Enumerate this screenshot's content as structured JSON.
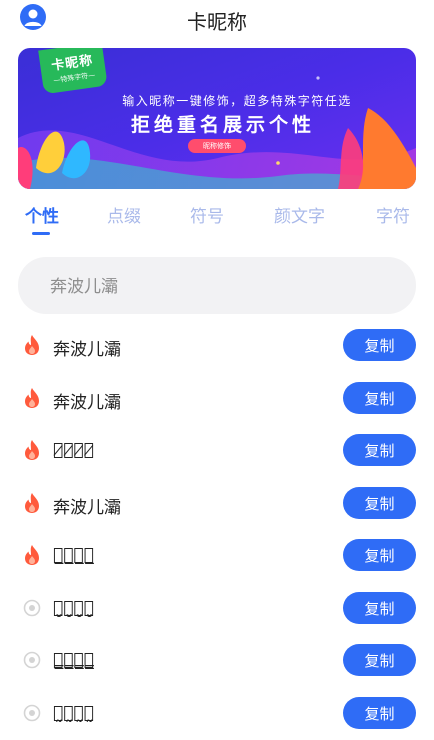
{
  "header": {
    "title": "卡昵称",
    "avatar_icon": "user-avatar-icon"
  },
  "banner": {
    "logo_title": "卡昵称",
    "logo_subtitle": "—特殊字符—",
    "subtitle": "输入昵称一键修饰，超多特殊字符任选",
    "headline": "拒绝重名展示个性",
    "pill_label": "昵称修饰"
  },
  "tabs": [
    {
      "label": "个性",
      "active": true
    },
    {
      "label": "点缀",
      "active": false
    },
    {
      "label": "符号",
      "active": false
    },
    {
      "label": "颜文字",
      "active": false
    },
    {
      "label": "字符",
      "active": false
    }
  ],
  "search": {
    "placeholder": "奔波儿灞"
  },
  "list": {
    "copy_label": "复制",
    "items": [
      {
        "text": "奔波儿灞",
        "icon": "fire-icon"
      },
      {
        "text": "奔波儿灞",
        "icon": "fire-icon"
      },
      {
        "text": "奔̷波̷儿̷灞̷",
        "icon": "fire-icon"
      },
      {
        "text": "奔波儿灞",
        "icon": "fire-icon"
      },
      {
        "text": "奔̲波̲儿̲灞̲",
        "icon": "fire-icon"
      },
      {
        "text": "奔̤̮波̤̮儿̤̮灞̤̮",
        "icon": "radio-icon"
      },
      {
        "text": "奔̳波̳儿̳灞̳",
        "icon": "radio-icon"
      },
      {
        "text": "奔̰波̰儿̰灞̰",
        "icon": "radio-icon"
      }
    ]
  },
  "colors": {
    "accent": "#2f6cf6",
    "fire": "#ff5a3c",
    "radio": "#d4d4d4"
  }
}
